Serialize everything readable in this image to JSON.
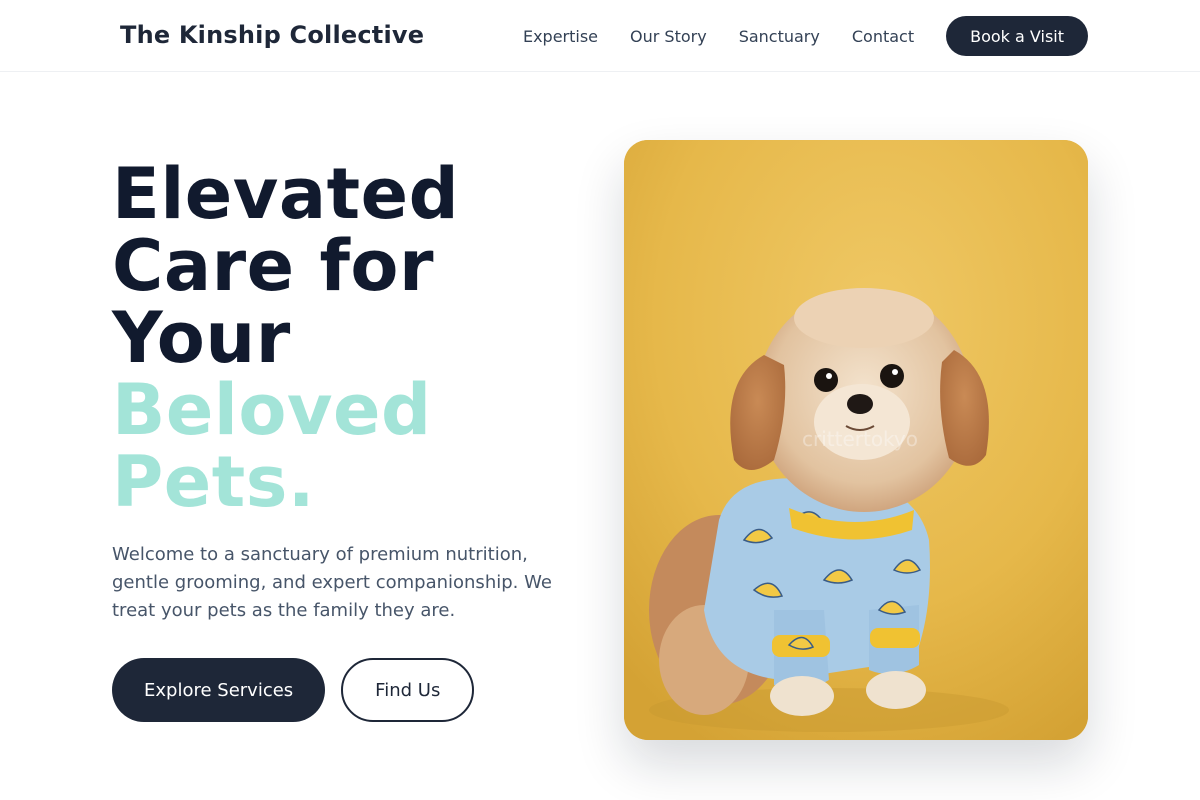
{
  "header": {
    "brand": "The Kinship Collective",
    "nav": [
      "Expertise",
      "Our Story",
      "Sanctuary",
      "Contact"
    ],
    "cta_label": "Book a Visit"
  },
  "hero": {
    "title_lines": [
      "Elevated",
      "Care for",
      "Your"
    ],
    "title_accent_lines": [
      "Beloved",
      "Pets."
    ],
    "description": "Welcome to a sanctuary of premium nutrition, gentle grooming, and expert companionship. We treat your pets as the family they are.",
    "primary_button": "Explore Services",
    "secondary_button": "Find Us",
    "image": {
      "subject": "small fluffy dog wearing blue banana-print pajamas on yellow background",
      "watermark": "crittertokyo"
    }
  },
  "colors": {
    "brand_dark": "#1e2738",
    "accent_mint": "#a3e4d8",
    "image_background": "#e6b84a",
    "text_muted": "#475569"
  }
}
